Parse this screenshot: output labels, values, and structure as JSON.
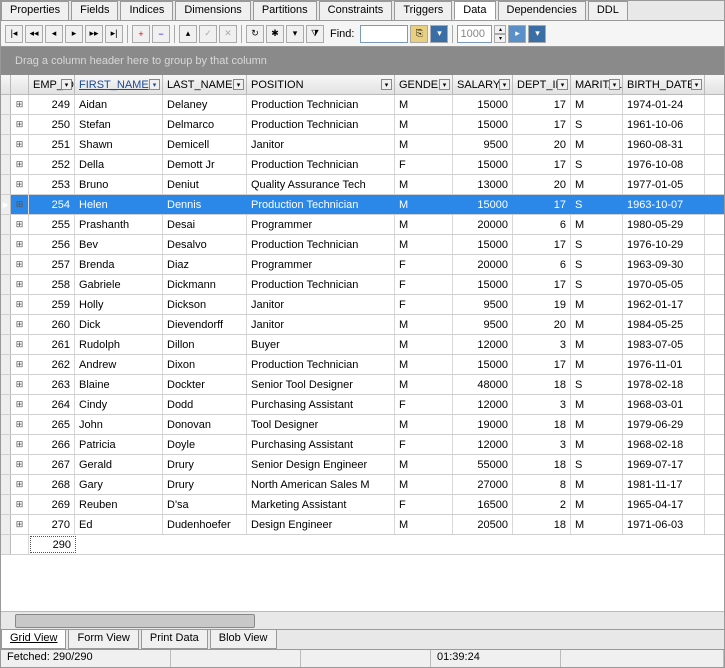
{
  "tabs_top": [
    "Properties",
    "Fields",
    "Indices",
    "Dimensions",
    "Partitions",
    "Constraints",
    "Triggers",
    "Data",
    "Dependencies",
    "DDL"
  ],
  "active_top": "Data",
  "toolbar": {
    "find_label": "Find:",
    "find_value": "",
    "page_value": "1000"
  },
  "group_bar": "Drag a column header here to group by that column",
  "columns": [
    {
      "key": "emp_id",
      "label": "EMP_ID",
      "w": "c-id",
      "num": true
    },
    {
      "key": "first_name",
      "label": "FIRST_NAME",
      "w": "c-fn",
      "sorted": true
    },
    {
      "key": "last_name",
      "label": "LAST_NAME",
      "w": "c-ln"
    },
    {
      "key": "position",
      "label": "POSITION",
      "w": "c-pos"
    },
    {
      "key": "gender",
      "label": "GENDER",
      "w": "c-gen"
    },
    {
      "key": "salary",
      "label": "SALARY",
      "w": "c-sal",
      "num": true
    },
    {
      "key": "dept_id",
      "label": "DEPT_ID",
      "w": "c-dept",
      "num": true
    },
    {
      "key": "marital",
      "label": "MARITAL",
      "w": "c-mar"
    },
    {
      "key": "birth_date",
      "label": "BIRTH_DATE",
      "w": "c-bd"
    }
  ],
  "selected_index": 5,
  "rows": [
    {
      "emp_id": "249",
      "first_name": "Aidan",
      "last_name": "Delaney",
      "position": "Production Technician",
      "gender": "M",
      "salary": "15000",
      "dept_id": "17",
      "marital": "M",
      "birth_date": "1974-01-24"
    },
    {
      "emp_id": "250",
      "first_name": "Stefan",
      "last_name": "Delmarco",
      "position": "Production Technician",
      "gender": "M",
      "salary": "15000",
      "dept_id": "17",
      "marital": "S",
      "birth_date": "1961-10-06"
    },
    {
      "emp_id": "251",
      "first_name": "Shawn",
      "last_name": "Demicell",
      "position": "Janitor",
      "gender": "M",
      "salary": "9500",
      "dept_id": "20",
      "marital": "M",
      "birth_date": "1960-08-31"
    },
    {
      "emp_id": "252",
      "first_name": "Della",
      "last_name": "Demott Jr",
      "position": "Production Technician",
      "gender": "F",
      "salary": "15000",
      "dept_id": "17",
      "marital": "S",
      "birth_date": "1976-10-08"
    },
    {
      "emp_id": "253",
      "first_name": "Bruno",
      "last_name": "Deniut",
      "position": "Quality Assurance Tech",
      "gender": "M",
      "salary": "13000",
      "dept_id": "20",
      "marital": "M",
      "birth_date": "1977-01-05"
    },
    {
      "emp_id": "254",
      "first_name": "Helen",
      "last_name": "Dennis",
      "position": "Production Technician",
      "gender": "M",
      "salary": "15000",
      "dept_id": "17",
      "marital": "S",
      "birth_date": "1963-10-07"
    },
    {
      "emp_id": "255",
      "first_name": "Prashanth",
      "last_name": "Desai",
      "position": "Programmer",
      "gender": "M",
      "salary": "20000",
      "dept_id": "6",
      "marital": "M",
      "birth_date": "1980-05-29"
    },
    {
      "emp_id": "256",
      "first_name": "Bev",
      "last_name": "Desalvo",
      "position": "Production Technician",
      "gender": "M",
      "salary": "15000",
      "dept_id": "17",
      "marital": "S",
      "birth_date": "1976-10-29"
    },
    {
      "emp_id": "257",
      "first_name": "Brenda",
      "last_name": "Diaz",
      "position": "Programmer",
      "gender": "F",
      "salary": "20000",
      "dept_id": "6",
      "marital": "S",
      "birth_date": "1963-09-30"
    },
    {
      "emp_id": "258",
      "first_name": "Gabriele",
      "last_name": "Dickmann",
      "position": "Production Technician",
      "gender": "F",
      "salary": "15000",
      "dept_id": "17",
      "marital": "S",
      "birth_date": "1970-05-05"
    },
    {
      "emp_id": "259",
      "first_name": "Holly",
      "last_name": "Dickson",
      "position": "Janitor",
      "gender": "F",
      "salary": "9500",
      "dept_id": "19",
      "marital": "M",
      "birth_date": "1962-01-17"
    },
    {
      "emp_id": "260",
      "first_name": "Dick",
      "last_name": "Dievendorff",
      "position": "Janitor",
      "gender": "M",
      "salary": "9500",
      "dept_id": "20",
      "marital": "M",
      "birth_date": "1984-05-25"
    },
    {
      "emp_id": "261",
      "first_name": "Rudolph",
      "last_name": "Dillon",
      "position": "Buyer",
      "gender": "M",
      "salary": "12000",
      "dept_id": "3",
      "marital": "M",
      "birth_date": "1983-07-05"
    },
    {
      "emp_id": "262",
      "first_name": "Andrew",
      "last_name": "Dixon",
      "position": "Production Technician",
      "gender": "M",
      "salary": "15000",
      "dept_id": "17",
      "marital": "M",
      "birth_date": "1976-11-01"
    },
    {
      "emp_id": "263",
      "first_name": "Blaine",
      "last_name": "Dockter",
      "position": "Senior Tool Designer",
      "gender": "M",
      "salary": "48000",
      "dept_id": "18",
      "marital": "S",
      "birth_date": "1978-02-18"
    },
    {
      "emp_id": "264",
      "first_name": "Cindy",
      "last_name": "Dodd",
      "position": "Purchasing Assistant",
      "gender": "F",
      "salary": "12000",
      "dept_id": "3",
      "marital": "M",
      "birth_date": "1968-03-01"
    },
    {
      "emp_id": "265",
      "first_name": "John",
      "last_name": "Donovan",
      "position": "Tool Designer",
      "gender": "M",
      "salary": "19000",
      "dept_id": "18",
      "marital": "M",
      "birth_date": "1979-06-29"
    },
    {
      "emp_id": "266",
      "first_name": "Patricia",
      "last_name": "Doyle",
      "position": "Purchasing Assistant",
      "gender": "F",
      "salary": "12000",
      "dept_id": "3",
      "marital": "M",
      "birth_date": "1968-02-18"
    },
    {
      "emp_id": "267",
      "first_name": "Gerald",
      "last_name": "Drury",
      "position": "Senior Design Engineer",
      "gender": "M",
      "salary": "55000",
      "dept_id": "18",
      "marital": "S",
      "birth_date": "1969-07-17"
    },
    {
      "emp_id": "268",
      "first_name": "Gary",
      "last_name": "Drury",
      "position": "North American Sales M",
      "gender": "M",
      "salary": "27000",
      "dept_id": "8",
      "marital": "M",
      "birth_date": "1981-11-17"
    },
    {
      "emp_id": "269",
      "first_name": "Reuben",
      "last_name": "D'sa",
      "position": "Marketing Assistant",
      "gender": "F",
      "salary": "16500",
      "dept_id": "2",
      "marital": "M",
      "birth_date": "1965-04-17"
    },
    {
      "emp_id": "270",
      "first_name": "Ed",
      "last_name": "Dudenhoefer",
      "position": "Design Engineer",
      "gender": "M",
      "salary": "20500",
      "dept_id": "18",
      "marital": "M",
      "birth_date": "1971-06-03"
    }
  ],
  "total_count": "290",
  "tabs_bottom": [
    "Grid View",
    "Form View",
    "Print Data",
    "Blob View"
  ],
  "active_bottom": "Grid View",
  "status": {
    "fetched": "Fetched: 290/290",
    "time": "01:39:24"
  }
}
